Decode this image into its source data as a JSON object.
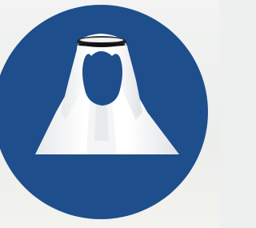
{
  "avatar": {
    "icon": "default-user-avatar-ghutra-icon",
    "background_color": "#1e4e8c",
    "ghutra_color": "#ffffff",
    "agal_color": "#1c1c1c"
  }
}
